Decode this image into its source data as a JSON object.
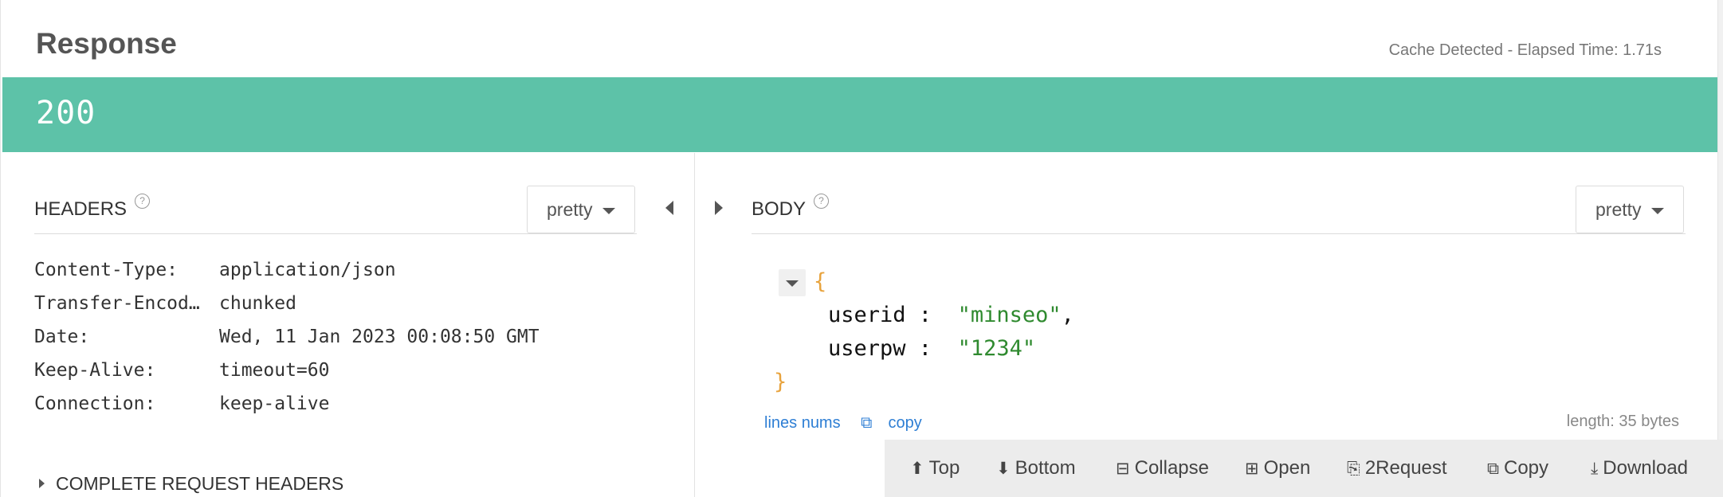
{
  "response": {
    "title": "Response",
    "meta": "Cache Detected - Elapsed Time: 1.71s",
    "status_code": "200",
    "status_color": "#5dc2a8"
  },
  "headers_panel": {
    "label": "HEADERS",
    "help_icon": "?",
    "format": "pretty",
    "rows": [
      {
        "key": "Content-Type:",
        "value": "application/json"
      },
      {
        "key": "Transfer-Encod…",
        "value": "chunked"
      },
      {
        "key": "Date:",
        "value": "Wed, 11 Jan 2023 00:08:50 GMT"
      },
      {
        "key": "Keep-Alive:",
        "value": "timeout=60"
      },
      {
        "key": "Connection:",
        "value": "keep-alive"
      }
    ],
    "complete_label": "COMPLETE REQUEST HEADERS"
  },
  "body_panel": {
    "label": "BODY",
    "help_icon": "?",
    "format": "pretty",
    "json": {
      "open_brace": "{",
      "close_brace": "}",
      "lines": [
        {
          "key": "userid",
          "colon": " :  ",
          "value": "\"minseo\"",
          "suffix": ","
        },
        {
          "key": "userpw",
          "colon": " :  ",
          "value": "\"1234\"",
          "suffix": ""
        }
      ]
    },
    "lines_nums": "lines nums",
    "copy_link": "copy",
    "length": "length: 35 bytes"
  },
  "toolbar": {
    "top": "Top",
    "bottom": "Bottom",
    "collapse": "Collapse",
    "open": "Open",
    "to_request": "2Request",
    "copy": "Copy",
    "download": "Download"
  },
  "icons": {
    "top": "arrow-up-circle-icon",
    "bottom": "arrow-down-circle-icon",
    "collapse": "minus-square-icon",
    "open": "plus-square-icon",
    "to_request": "file-copy-icon",
    "copy": "copy-icon",
    "download": "download-icon"
  }
}
